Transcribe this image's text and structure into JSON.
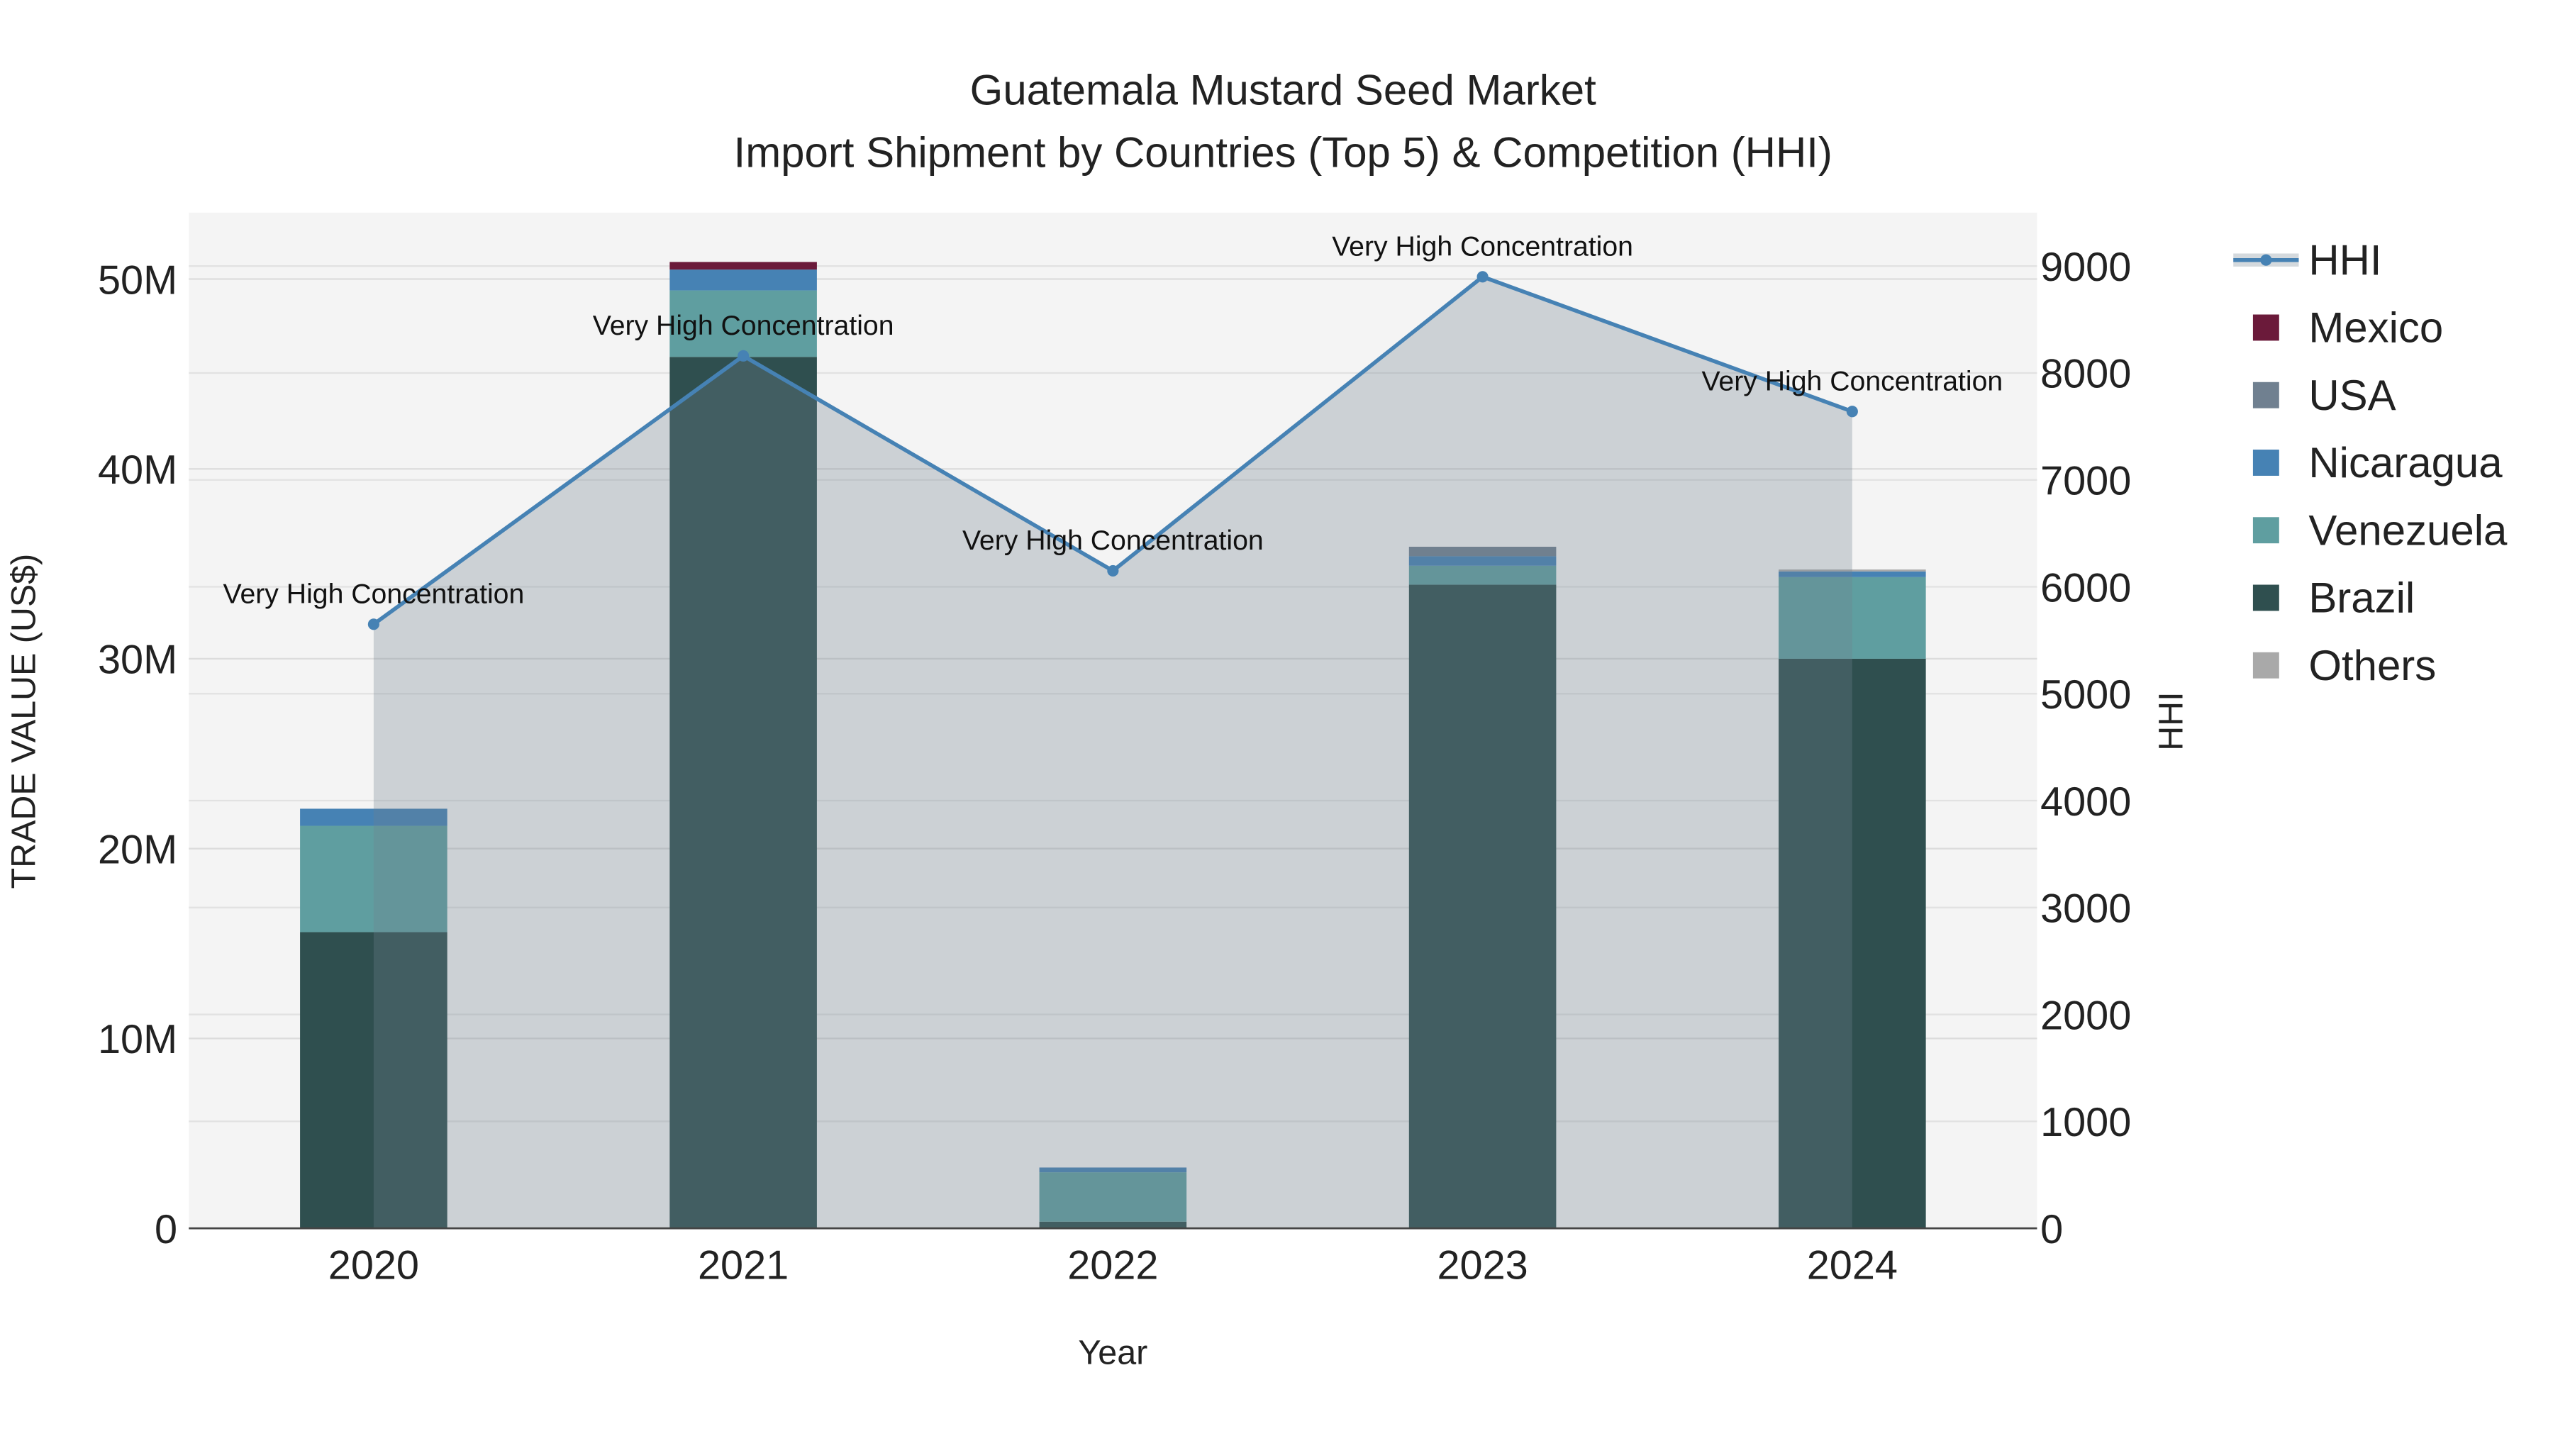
{
  "chart_data": {
    "type": "bar",
    "title": "Guatemala Mustard Seed Market",
    "subtitle": "Import Shipment by Countries (Top 5) & Competition (HHI)",
    "xlabel": "Year",
    "ylabel": "TRADE VALUE (US$)",
    "y2label": "HHI",
    "categories": [
      "2020",
      "2021",
      "2022",
      "2023",
      "2024"
    ],
    "ylim": [
      0,
      53.5
    ],
    "y_ticks": [
      0,
      10,
      20,
      30,
      40,
      50
    ],
    "y_tick_labels": [
      "0",
      "10M",
      "20M",
      "30M",
      "40M",
      "50M"
    ],
    "y2lim": [
      0,
      9500
    ],
    "y2_ticks": [
      0,
      1000,
      2000,
      3000,
      4000,
      5000,
      6000,
      7000,
      8000,
      9000
    ],
    "y2_tick_labels": [
      "0",
      "1000",
      "2000",
      "3000",
      "4000",
      "5000",
      "6000",
      "7000",
      "8000",
      "9000"
    ],
    "units": "million US$",
    "stacked": true,
    "series": [
      {
        "name": "Brazil",
        "color": "#2f4f4f",
        "values": [
          15.6,
          45.9,
          0.35,
          33.9,
          30.0
        ]
      },
      {
        "name": "Venezuela",
        "color": "#5f9ea0",
        "values": [
          5.6,
          3.5,
          2.6,
          1.0,
          4.3
        ]
      },
      {
        "name": "Nicaragua",
        "color": "#4682b4",
        "values": [
          0.9,
          1.1,
          0.25,
          0.5,
          0.3
        ]
      },
      {
        "name": "USA",
        "color": "#708090",
        "values": [
          0,
          0,
          0,
          0.5,
          0
        ]
      },
      {
        "name": "Mexico",
        "color": "#6b1a3a",
        "values": [
          0,
          0.4,
          0,
          0,
          0
        ]
      },
      {
        "name": "Others",
        "color": "#a9a9a9",
        "values": [
          0,
          0,
          0,
          0,
          0.1
        ]
      }
    ],
    "hhi": {
      "name": "HHI",
      "color": "#4682b4",
      "values": [
        5650,
        8160,
        6150,
        8900,
        7640
      ],
      "annotations": [
        "Very High Concentration",
        "Very High Concentration",
        "Very High Concentration",
        "Very High Concentration",
        "Very High Concentration"
      ]
    },
    "legend": {
      "placement": "right",
      "entries": [
        "HHI",
        "Mexico",
        "USA",
        "Nicaragua",
        "Venezuela",
        "Brazil",
        "Others"
      ]
    },
    "grid": true
  }
}
